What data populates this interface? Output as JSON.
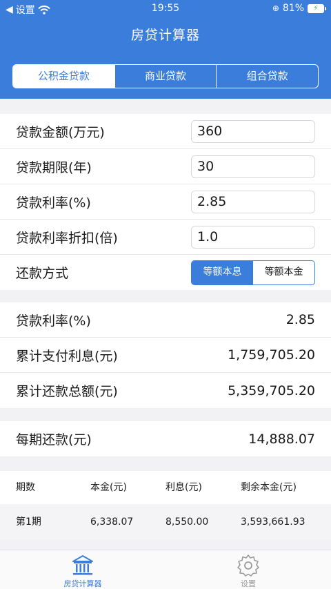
{
  "status": {
    "carrier": "设置",
    "time": "19:55",
    "battery": "81%"
  },
  "nav": {
    "title": "房贷计算器"
  },
  "segments": [
    "公积金贷款",
    "商业贷款",
    "组合贷款"
  ],
  "form": {
    "amount_label": "贷款金额(万元)",
    "amount_value": "360",
    "term_label": "贷款期限(年)",
    "term_value": "30",
    "rate_label": "贷款利率(%)",
    "rate_value": "2.85",
    "discount_label": "贷款利率折扣(倍)",
    "discount_value": "1.0",
    "method_label": "还款方式",
    "method_options": [
      "等额本息",
      "等额本金"
    ]
  },
  "summary": {
    "rate_label": "贷款利率(%)",
    "rate_value": "2.85",
    "interest_label": "累计支付利息(元)",
    "interest_value": "1,759,705.20",
    "total_label": "累计还款总额(元)",
    "total_value": "5,359,705.20"
  },
  "monthly": {
    "label": "每期还款(元)",
    "value": "14,888.07"
  },
  "schedule": {
    "headers": [
      "期数",
      "本金(元)",
      "利息(元)",
      "剩余本金(元)"
    ],
    "rows": [
      [
        "第1期",
        "6,338.07",
        "8,550.00",
        "3,593,661.93"
      ]
    ]
  },
  "tabs": [
    "房贷计算器",
    "设置"
  ],
  "colors": {
    "primary": "#3b7ddb",
    "background": "#f2f2f4"
  }
}
